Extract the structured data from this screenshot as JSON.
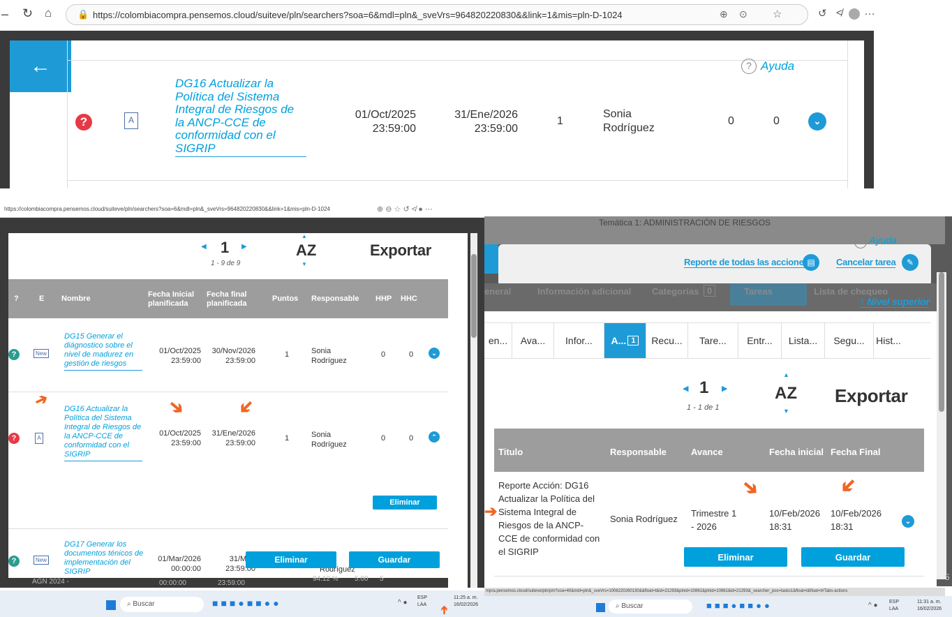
{
  "top": {
    "url": "https://colombiacompra.pensemos.cloud/suiteve/pln/searchers?soa=6&mdl=pln&_sveVrs=964820220830&&link=1&mis=pln-D-1024",
    "help": "Ayuda",
    "task_name": "DG16 Actualizar la Política del Sistema Integral de Riesgos de la ANCP-CCE de conformidad con el SIGRIP",
    "start_date": "01/Oct/2025",
    "start_time": "23:59:00",
    "end_date": "31/Ene/2026",
    "end_time": "23:59:00",
    "points": "1",
    "responsible": "Sonia Rodríguez",
    "hhp": "0",
    "hhc": "0",
    "help_icon": "?",
    "back_arrow": "←"
  },
  "left": {
    "url": "https://colombiacompra.pensemos.cloud/suiteve/pln/searchers?soa=6&mdl=pln&_sveVrs=964820220830&&link=1&mis=pln-D-1024",
    "page": "1",
    "page_range": "1 - 9 de 9",
    "sort": "AZ",
    "export": "Exportar",
    "headers": [
      "?",
      "E",
      "Nombre",
      "Fecha Inicial planificada",
      "Fecha final planificada",
      "Puntos",
      "Responsable",
      "HHP",
      "HHC"
    ],
    "rows": [
      {
        "name": "DG15 Generar el diágnostico sobre el nivel de madurez en gestión de riesgos",
        "start": "01/Oct/2025",
        "start_t": "23:59:00",
        "end": "30/Nov/2026",
        "end_t": "23:59:00",
        "points": "1",
        "resp": "Sonia Rodríguez",
        "hhp": "0",
        "hhc": "0",
        "badge": "New"
      },
      {
        "name": "DG16 Actualizar la Política del Sistema Integral de Riesgos de la ANCP-CCE de conformidad con el SIGRIP",
        "start": "01/Oct/2025",
        "start_t": "23:59:00",
        "end": "31/Ene/2026",
        "end_t": "23:59:00",
        "points": "1",
        "resp": "Sonia Rodríguez",
        "hhp": "0",
        "hhc": "0"
      },
      {
        "name": "DG17 Generar los documentos ténicos de implementación del SIGRIP",
        "start": "01/Mar/2026",
        "start_t": "00:00:00",
        "end": "31/Mar/",
        "end_t": "23:59:00",
        "resp": "Rodríguez",
        "badge": "New"
      }
    ],
    "delete": "Eliminar",
    "delete2": "Eliminar",
    "save": "Guardar",
    "bottom_row": {
      "code": "AGN 2024 -",
      "time1": "00:00:00",
      "time2": "23:59:00",
      "pct": "94.12 %",
      "val": "5.00",
      "val2": "5"
    },
    "taskbar": {
      "search": "Buscar",
      "lang": "ESP",
      "lang2": "LAA",
      "time": "11:25 a. m.",
      "date": "16/02/2026"
    }
  },
  "right": {
    "top_text": "Temática 1: ADMINISTRACIÓN DE RIESGOS",
    "help": "Ayuda",
    "report_all": "Reporte de todas las acciones",
    "cancel_task": "Cancelar tarea",
    "faded_tabs": [
      "eneral",
      "Información adicional",
      "Categorías",
      "Tareas",
      "Lista de chequeo"
    ],
    "faded_count": "0",
    "up_level": "↑ Nivel superior",
    "tabs": [
      "en...",
      "Ava...",
      "Infor...",
      "A...",
      "Recu...",
      "Tare...",
      "Entr...",
      "Lista...",
      "Segu...",
      "Hist..."
    ],
    "tab_badge": "1",
    "page": "1",
    "page_range": "1 - 1 de 1",
    "sort": "AZ",
    "export": "Exportar",
    "headers": [
      "Titulo",
      "Responsable",
      "Avance",
      "Fecha inicial",
      "Fecha Final"
    ],
    "row": {
      "title": "Reporte Acción: DG16 Actualizar la Política del Sistema Integral de Riesgos de la ANCP-CCE de conformidad con el SIGRIP",
      "resp": "Sonia Rodríguez",
      "adv": "Trimestre 1 - 2026",
      "start": "10/Feb/2026",
      "start_t": "18:31",
      "end": "10/Feb/2026",
      "end_t": "18:31"
    },
    "delete": "Eliminar",
    "save": "Guardar",
    "status_url": "mpra.pensemos.cloud/suiteve/pln/pln?soa=40&mdl=pln&_sveVrs=1006220260130&&float=t&id=21293&plnid=10861&plnid=10861&id=21293&_searcher_pos=tasks1&float=t&float=t#Tabs-actions",
    "taskbar": {
      "search": "Buscar",
      "lang": "ESP",
      "lang2": "LAA",
      "time": "11:31 a. m.",
      "date": "16/02/2026"
    },
    "side_num": "5"
  }
}
